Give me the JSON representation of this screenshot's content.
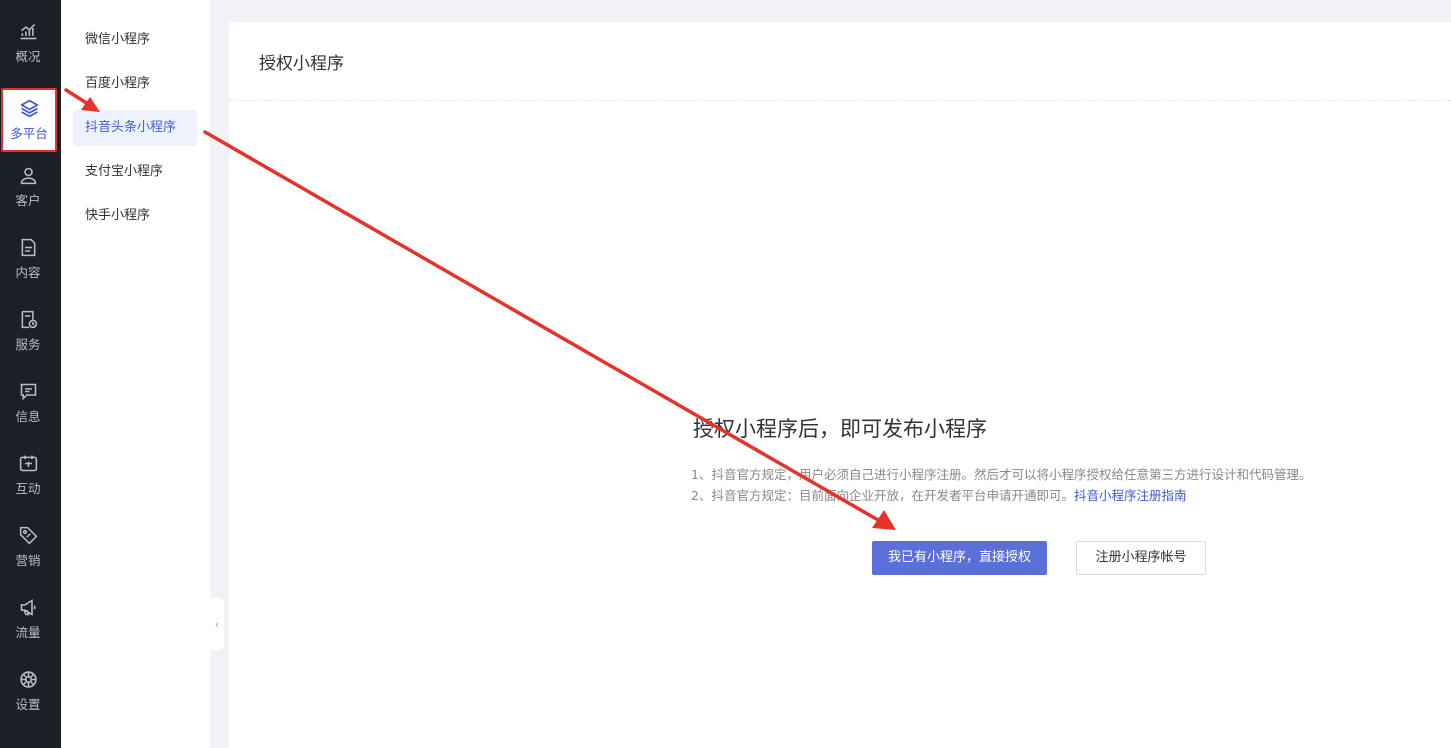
{
  "rail": {
    "items": [
      {
        "label": "概况",
        "icon": "chart-line-icon"
      },
      {
        "label": "多平台",
        "icon": "layers-icon"
      },
      {
        "label": "客户",
        "icon": "user-icon"
      },
      {
        "label": "内容",
        "icon": "document-icon"
      },
      {
        "label": "服务",
        "icon": "service-icon"
      },
      {
        "label": "信息",
        "icon": "message-icon"
      },
      {
        "label": "互动",
        "icon": "interaction-icon"
      },
      {
        "label": "营销",
        "icon": "tag-icon"
      },
      {
        "label": "流量",
        "icon": "megaphone-icon"
      },
      {
        "label": "设置",
        "icon": "settings-icon"
      }
    ]
  },
  "subnav": {
    "items": [
      {
        "label": "微信小程序"
      },
      {
        "label": "百度小程序"
      },
      {
        "label": "抖音头条小程序"
      },
      {
        "label": "支付宝小程序"
      },
      {
        "label": "快手小程序"
      }
    ]
  },
  "main": {
    "title": "授权小程序",
    "heading": "授权小程序后，即可发布小程序",
    "note1": "1、抖音官方规定，用户必须自己进行小程序注册。然后才可以将小程序授权给任意第三方进行设计和代码管理。",
    "note2": "2、抖音官方规定：目前面向企业开放，在开发者平台申请开通即可。",
    "note2_link": "抖音小程序注册指南",
    "primary_button": "我已有小程序，直接授权",
    "secondary_button": "注册小程序帐号"
  },
  "colors": {
    "rail_bg": "#1d1f26",
    "accent": "#5b6fd8",
    "annotation": "#e5332a"
  }
}
